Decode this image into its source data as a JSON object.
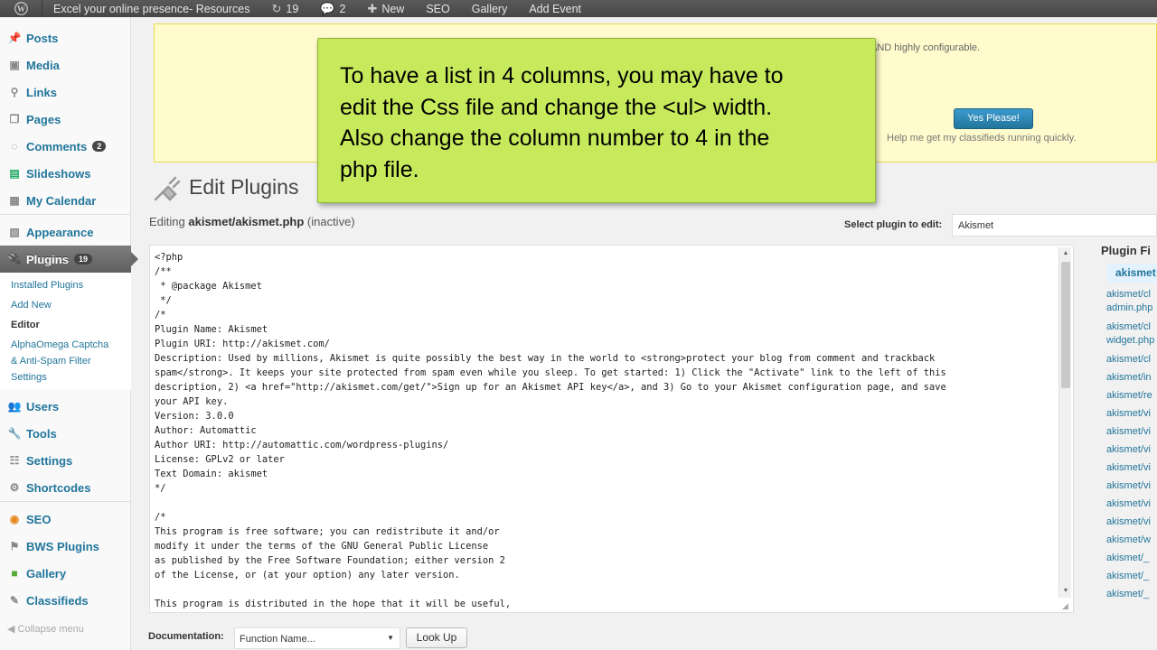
{
  "admin_bar": {
    "site_name": "Excel your online presence- Resources",
    "updates_count": "19",
    "comments_count": "2",
    "new_label": "New",
    "seo_label": "SEO",
    "gallery_label": "Gallery",
    "add_event_label": "Add Event"
  },
  "sidebar": {
    "items": [
      {
        "label": "Posts",
        "icon": "pin-icon"
      },
      {
        "label": "Media",
        "icon": "media-icon"
      },
      {
        "label": "Links",
        "icon": "links-icon"
      },
      {
        "label": "Pages",
        "icon": "pages-icon"
      },
      {
        "label": "Comments",
        "icon": "comments-icon",
        "count": "2"
      },
      {
        "label": "Slideshows",
        "icon": "slideshow-icon"
      },
      {
        "label": "My Calendar",
        "icon": "calendar-icon"
      },
      {
        "label": "Appearance",
        "icon": "appearance-icon"
      },
      {
        "label": "Plugins",
        "icon": "plugins-icon",
        "count": "19"
      },
      {
        "label": "Users",
        "icon": "users-icon"
      },
      {
        "label": "Tools",
        "icon": "tools-icon"
      },
      {
        "label": "Settings",
        "icon": "settings-icon"
      },
      {
        "label": "Shortcodes",
        "icon": "shortcodes-icon"
      },
      {
        "label": "SEO",
        "icon": "seo-icon"
      },
      {
        "label": "BWS Plugins",
        "icon": "bws-icon"
      },
      {
        "label": "Gallery",
        "icon": "gallery-icon"
      },
      {
        "label": "Classifieds",
        "icon": "classifieds-icon"
      }
    ],
    "plugins_submenu": [
      "Installed Plugins",
      "Add New",
      "Editor",
      "AlphaOmega Captcha",
      "& Anti-Spam Filter",
      "Settings"
    ],
    "collapse_label": "Collapse menu"
  },
  "notice": {
    "text": "AND highly configurable.",
    "button_label": "Yes Please!",
    "help_text": "Help me get my classifieds running quickly."
  },
  "callout": {
    "text": "To have a list in 4 columns, you may have to\nedit the Css file and change the <ul> width.\nAlso change the column number to 4 in the\nphp file."
  },
  "page": {
    "title": "Edit Plugins",
    "editing_prefix": "Editing",
    "editing_file": "akismet/akismet.php",
    "editing_status": "(inactive)",
    "select_label": "Select plugin to edit:",
    "select_value": "Akismet"
  },
  "editor": {
    "code": "<?php\n/**\n * @package Akismet\n */\n/*\nPlugin Name: Akismet\nPlugin URI: http://akismet.com/\nDescription: Used by millions, Akismet is quite possibly the best way in the world to <strong>protect your blog from comment and trackback\nspam</strong>. It keeps your site protected from spam even while you sleep. To get started: 1) Click the \"Activate\" link to the left of this\ndescription, 2) <a href=\"http://akismet.com/get/\">Sign up for an Akismet API key</a>, and 3) Go to your Akismet configuration page, and save\nyour API key.\nVersion: 3.0.0\nAuthor: Automattic\nAuthor URI: http://automattic.com/wordpress-plugins/\nLicense: GPLv2 or later\nText Domain: akismet\n*/\n\n/*\nThis program is free software; you can redistribute it and/or\nmodify it under the terms of the GNU General Public License\nas published by the Free Software Foundation; either version 2\nof the License, or (at your option) any later version.\n\nThis program is distributed in the hope that it will be useful,"
  },
  "documentation": {
    "label": "Documentation:",
    "select_value": "Function Name...",
    "button_label": "Look Up"
  },
  "plugin_files": {
    "heading": "Plugin Fi",
    "active": "akismet",
    "files": [
      "akismet/cl\nadmin.php",
      "akismet/cl\nwidget.php",
      "akismet/cl",
      "akismet/in",
      "akismet/re",
      "akismet/vi",
      "akismet/vi",
      "akismet/vi",
      "akismet/vi",
      "akismet/vi",
      "akismet/vi",
      "akismet/vi",
      "akismet/w",
      "akismet/_",
      "akismet/_",
      "akismet/_"
    ]
  },
  "colors": {
    "admin_bar_bg": "#464646",
    "link": "#21759b",
    "callout_bg": "#c7ea5c",
    "notice_bg": "#fffbcc",
    "button_primary": "#21759b"
  }
}
